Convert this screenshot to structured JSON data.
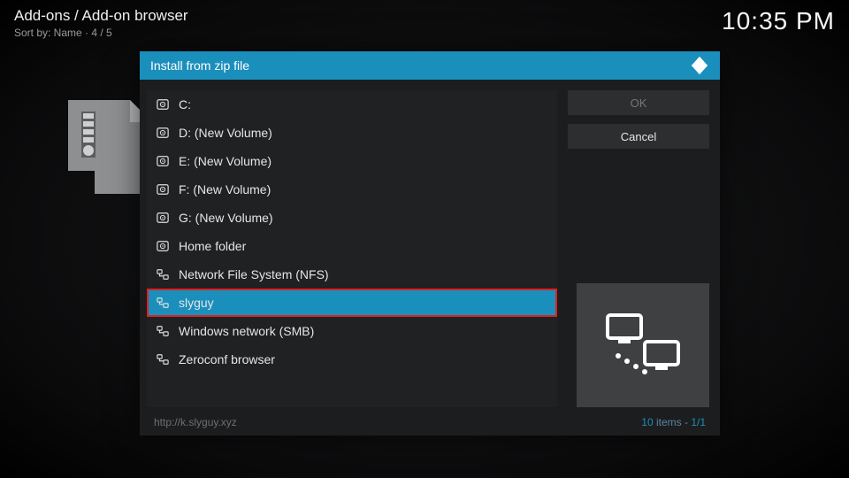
{
  "header": {
    "breadcrumb": "Add-ons / Add-on browser",
    "sort_line": "Sort by: Name  ·  4 / 5",
    "clock": "10:35 PM"
  },
  "dialog": {
    "title": "Install from zip file",
    "ok_label": "OK",
    "cancel_label": "Cancel",
    "footer_path": "http://k.slyguy.xyz",
    "footer_count_num": "10",
    "footer_count_word": " items - ",
    "footer_page": "1/1"
  },
  "list": {
    "items": [
      {
        "icon": "disk",
        "label": "C:"
      },
      {
        "icon": "disk",
        "label": "D: (New Volume)"
      },
      {
        "icon": "disk",
        "label": "E: (New Volume)"
      },
      {
        "icon": "disk",
        "label": "F: (New Volume)"
      },
      {
        "icon": "disk",
        "label": "G: (New Volume)"
      },
      {
        "icon": "disk",
        "label": "Home folder"
      },
      {
        "icon": "net",
        "label": "Network File System (NFS)"
      },
      {
        "icon": "net",
        "label": "slyguy",
        "selected": true,
        "highlight": true
      },
      {
        "icon": "net",
        "label": "Windows network (SMB)"
      },
      {
        "icon": "net",
        "label": "Zeroconf browser"
      }
    ]
  }
}
